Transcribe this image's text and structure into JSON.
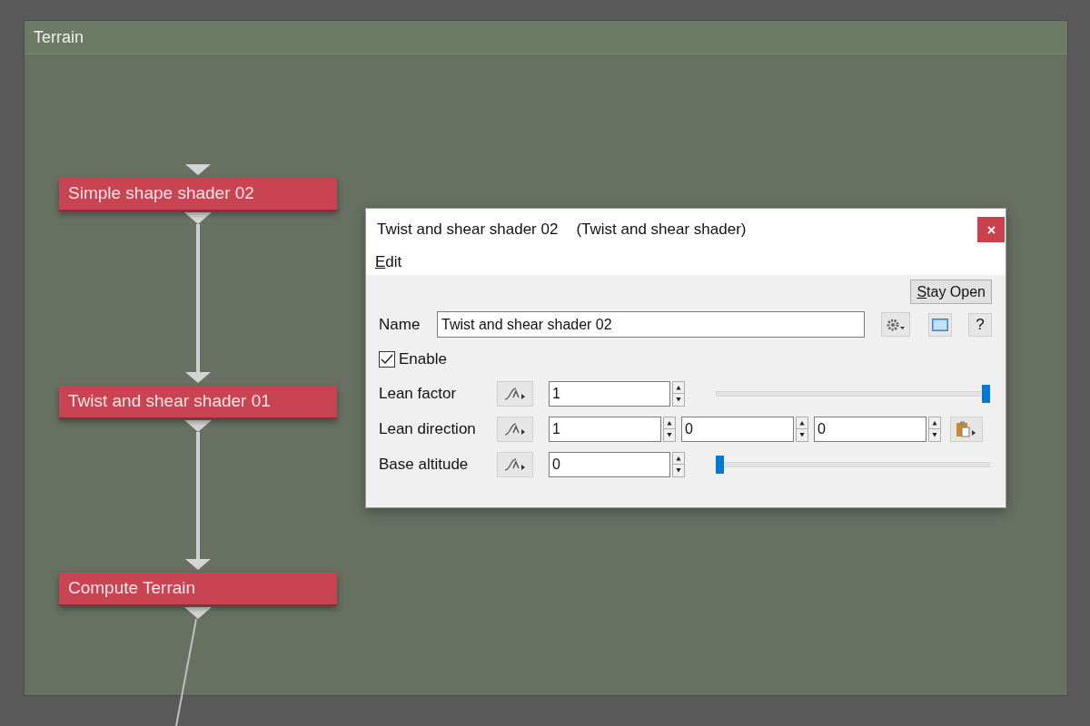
{
  "panel": {
    "title": "Terrain"
  },
  "nodes": [
    {
      "label": "Simple shape shader 02"
    },
    {
      "label": "Twist and shear shader 01"
    },
    {
      "label": "Compute Terrain"
    }
  ],
  "dialog": {
    "title": "Twist and shear shader 02",
    "subtitle": "(Twist and shear shader)",
    "menu": [
      "Edit"
    ],
    "stay_open": "Stay Open",
    "name_label": "Name",
    "name_value": "Twist and shear shader 02",
    "help": "?",
    "enable": {
      "label": "Enable",
      "checked": true
    },
    "params": [
      {
        "kind": "slider",
        "label": "Lean factor",
        "values": [
          "1"
        ],
        "level": 1
      },
      {
        "kind": "vector",
        "label": "Lean direction",
        "values": [
          "1",
          "0",
          "0"
        ]
      },
      {
        "kind": "slider",
        "label": "Base altitude",
        "values": [
          "0"
        ],
        "level": 0
      }
    ]
  }
}
